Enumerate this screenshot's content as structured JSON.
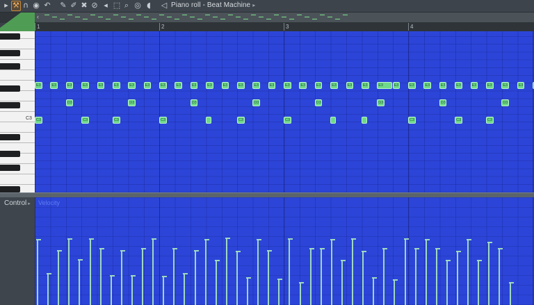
{
  "toolbar": {
    "title": "Piano roll - Beat Machine",
    "icons": [
      "wrench-icon",
      "magnet-icon",
      "record-icon",
      "undo-icon",
      "pencil-icon",
      "paint-icon",
      "delete-icon",
      "mute-icon",
      "slice-icon",
      "select-icon",
      "zoom-icon",
      "playback-icon",
      "speaker-icon"
    ]
  },
  "ruler": {
    "bars": [
      "1",
      "2",
      "3",
      "4"
    ]
  },
  "keyboard": {
    "c3_label": "C3"
  },
  "notes": [
    {
      "label": "E3",
      "row": "e3",
      "start": 0.0,
      "len": 0.06
    },
    {
      "label": "E3",
      "row": "e3",
      "start": 0.125,
      "len": 0.06
    },
    {
      "label": "E3",
      "row": "e3",
      "start": 0.25,
      "len": 0.06
    },
    {
      "label": "E3",
      "row": "e3",
      "start": 0.375,
      "len": 0.06
    },
    {
      "label": "E3",
      "row": "e3",
      "start": 0.5,
      "len": 0.06
    },
    {
      "label": "E3",
      "row": "e3",
      "start": 0.625,
      "len": 0.06
    },
    {
      "label": "E3",
      "row": "e3",
      "start": 0.75,
      "len": 0.06
    },
    {
      "label": "E3",
      "row": "e3",
      "start": 0.875,
      "len": 0.06
    },
    {
      "label": "E3",
      "row": "e3",
      "start": 1.0,
      "len": 0.06
    },
    {
      "label": "E3",
      "row": "e3",
      "start": 1.125,
      "len": 0.06
    },
    {
      "label": "E3",
      "row": "e3",
      "start": 1.25,
      "len": 0.06
    },
    {
      "label": "E3",
      "row": "e3",
      "start": 1.375,
      "len": 0.06
    },
    {
      "label": "E3",
      "row": "e3",
      "start": 1.5,
      "len": 0.06
    },
    {
      "label": "E3",
      "row": "e3",
      "start": 1.625,
      "len": 0.06
    },
    {
      "label": "E3",
      "row": "e3",
      "start": 1.75,
      "len": 0.06
    },
    {
      "label": "E3",
      "row": "e3",
      "start": 1.875,
      "len": 0.06
    },
    {
      "label": "E3",
      "row": "e3",
      "start": 2.0,
      "len": 0.06
    },
    {
      "label": "E3",
      "row": "e3",
      "start": 2.125,
      "len": 0.06
    },
    {
      "label": "E3",
      "row": "e3",
      "start": 2.25,
      "len": 0.06
    },
    {
      "label": "E3",
      "row": "e3",
      "start": 2.375,
      "len": 0.06
    },
    {
      "label": "E3",
      "row": "e3",
      "start": 2.5,
      "len": 0.06
    },
    {
      "label": "E3",
      "row": "e3",
      "start": 2.625,
      "len": 0.06
    },
    {
      "label": "E3",
      "row": "e3",
      "start": 2.75,
      "len": 0.12
    },
    {
      "label": "E3",
      "row": "e3",
      "start": 2.875,
      "len": 0.06
    },
    {
      "label": "E3",
      "row": "e3",
      "start": 3.0,
      "len": 0.06
    },
    {
      "label": "E3",
      "row": "e3",
      "start": 3.125,
      "len": 0.06
    },
    {
      "label": "E3",
      "row": "e3",
      "start": 3.25,
      "len": 0.06
    },
    {
      "label": "E3",
      "row": "e3",
      "start": 3.375,
      "len": 0.06
    },
    {
      "label": "E3",
      "row": "e3",
      "start": 3.5,
      "len": 0.06
    },
    {
      "label": "E3",
      "row": "e3",
      "start": 3.625,
      "len": 0.06
    },
    {
      "label": "E3",
      "row": "e3",
      "start": 3.75,
      "len": 0.06
    },
    {
      "label": "E3",
      "row": "e3",
      "start": 3.875,
      "len": 0.06
    },
    {
      "label": "E3",
      "row": "e3",
      "start": 4.0,
      "len": 0.06
    },
    {
      "label": "E3",
      "row": "e3",
      "start": 4.125,
      "len": 0.06
    },
    {
      "label": "E3",
      "row": "e3",
      "start": 4.25,
      "len": 0.06
    },
    {
      "label": "E3",
      "row": "e3",
      "start": 4.375,
      "len": 0.06
    },
    {
      "label": "E3",
      "row": "e3",
      "start": 4.5,
      "len": 0.06
    },
    {
      "label": "E3",
      "row": "e3",
      "start": 4.625,
      "len": 0.06
    },
    {
      "label": "F3",
      "row": "f3",
      "start": 4.75,
      "len": 0.06
    },
    {
      "label": "D3",
      "row": "d3",
      "start": 0.25,
      "len": 0.06
    },
    {
      "label": "D3",
      "row": "d3",
      "start": 0.75,
      "len": 0.06
    },
    {
      "label": "D3",
      "row": "d3",
      "start": 1.25,
      "len": 0.06
    },
    {
      "label": "D3",
      "row": "d3",
      "start": 1.75,
      "len": 0.06
    },
    {
      "label": "D3",
      "row": "d3",
      "start": 2.25,
      "len": 0.06
    },
    {
      "label": "D3",
      "row": "d3",
      "start": 2.75,
      "len": 0.06
    },
    {
      "label": "D3",
      "row": "d3",
      "start": 3.25,
      "len": 0.06
    },
    {
      "label": "D3",
      "row": "d3",
      "start": 3.75,
      "len": 0.06
    },
    {
      "label": "D3",
      "row": "d3",
      "start": 4.25,
      "len": 0.06
    },
    {
      "label": "C3",
      "row": "c3",
      "start": 0.0,
      "len": 0.06
    },
    {
      "label": "C3",
      "row": "c3",
      "start": 0.375,
      "len": 0.06
    },
    {
      "label": "C3",
      "row": "c3",
      "start": 0.625,
      "len": 0.06
    },
    {
      "label": "C3",
      "row": "c3",
      "start": 1.0,
      "len": 0.06
    },
    {
      "label": "",
      "row": "c3",
      "start": 1.375,
      "len": 0.04
    },
    {
      "label": "C3",
      "row": "c3",
      "start": 1.625,
      "len": 0.06
    },
    {
      "label": "C3",
      "row": "c3",
      "start": 2.0,
      "len": 0.06
    },
    {
      "label": "",
      "row": "c3",
      "start": 2.375,
      "len": 0.04
    },
    {
      "label": "",
      "row": "c3",
      "start": 2.625,
      "len": 0.04
    },
    {
      "label": "C3",
      "row": "c3",
      "start": 3.0,
      "len": 0.06
    },
    {
      "label": "C3",
      "row": "c3",
      "start": 3.375,
      "len": 0.06
    },
    {
      "label": "C3",
      "row": "c3",
      "start": 3.625,
      "len": 0.06
    }
  ],
  "control": {
    "label": "Control",
    "parameter": "Velocity",
    "velocities": [
      0.72,
      0.35,
      0.6,
      0.73,
      0.5,
      0.73,
      0.62,
      0.33,
      0.6,
      0.33,
      0.62,
      0.73,
      0.32,
      0.62,
      0.35,
      0.6,
      0.72,
      0.49,
      0.74,
      0.59,
      0.3,
      0.72,
      0.6,
      0.29,
      0.73,
      0.25,
      0.62,
      0.62,
      0.72,
      0.49,
      0.73,
      0.59,
      0.3,
      0.62,
      0.28,
      0.73,
      0.62,
      0.72,
      0.62,
      0.49,
      0.59,
      0.72,
      0.49,
      0.69,
      0.62,
      0.25
    ]
  },
  "colors": {
    "grid": "#2c45d8",
    "note": "#6fd88a",
    "velocity": "#9fd9c0",
    "accent": "#c98a3b"
  }
}
